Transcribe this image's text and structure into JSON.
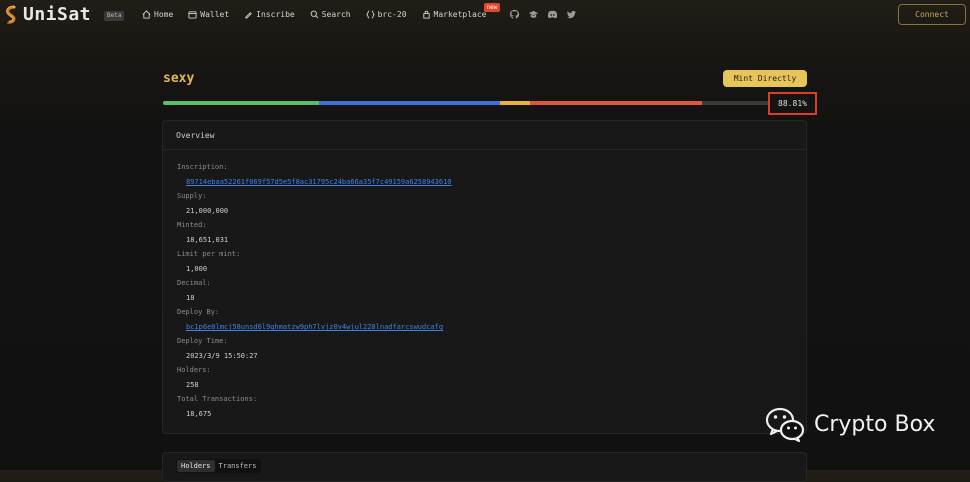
{
  "header": {
    "brand": "UniSat",
    "beta": "Beta",
    "nav": [
      {
        "icon": "home-icon",
        "label": "Home"
      },
      {
        "icon": "wallet-icon",
        "label": "Wallet"
      },
      {
        "icon": "pen-icon",
        "label": "Inscribe"
      },
      {
        "icon": "search-icon",
        "label": "Search"
      },
      {
        "icon": "braces-icon",
        "label": "brc-20"
      },
      {
        "icon": "lock-icon",
        "label": "Marketplace"
      }
    ],
    "new_badge": "new",
    "social": [
      "github-icon",
      "graduation-cap-icon",
      "discord-icon",
      "twitter-icon"
    ],
    "connect_label": "Connect"
  },
  "token": {
    "name": "sexy",
    "mint_label": "Mint Directly",
    "progress_percent": 88.81,
    "progress_text": "88.81%",
    "progress_colors": [
      "#5bbf6a",
      "#3d6fe0",
      "#e8b23a",
      "#e0563a"
    ]
  },
  "overview": {
    "title": "Overview",
    "fields": [
      {
        "label": "Inscription:",
        "value": "89714ebaa52261f069f57d5e5f8ac31795c24ba66a35f7c49159a6258943610",
        "link": true
      },
      {
        "label": "Supply:",
        "value": "21,000,000",
        "link": false
      },
      {
        "label": "Minted:",
        "value": "18,651,031",
        "link": false
      },
      {
        "label": "Limit per mint:",
        "value": "1,000",
        "link": false
      },
      {
        "label": "Decimal:",
        "value": "18",
        "link": false
      },
      {
        "label": "Deploy By:",
        "value": "bc1p6e0lmcj58unsd6l9qhmatzw9ph7lvjz0v4wjul228lnadfarcswudcafq",
        "link": true
      },
      {
        "label": "Deploy Time:",
        "value": "2023/3/9 15:50:27",
        "link": false
      },
      {
        "label": "Holders:",
        "value": "258",
        "link": false
      },
      {
        "label": "Total Transactions:",
        "value": "18,675",
        "link": false
      }
    ]
  },
  "tabs": [
    "Holders",
    "Transfers"
  ],
  "watermark": "Crypto Box"
}
